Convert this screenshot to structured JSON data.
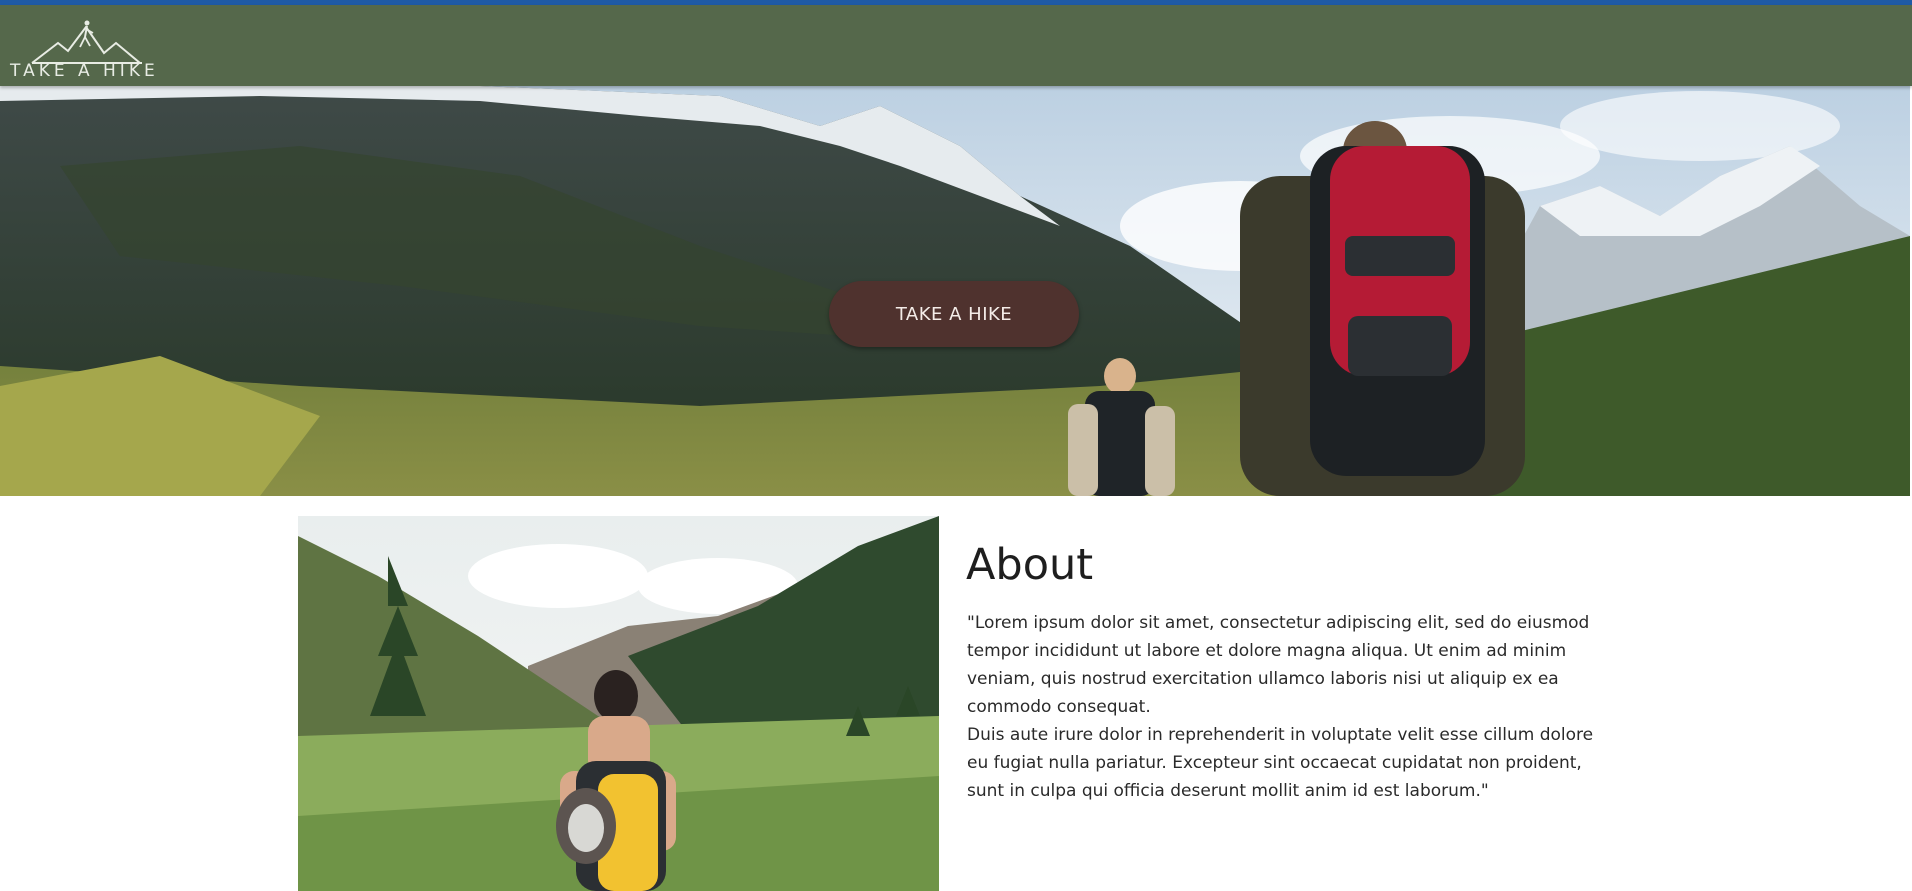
{
  "brand": {
    "name": "TAKE A HIKE",
    "logo_icon": "mountain-hiker-icon"
  },
  "hero": {
    "cta_label": "TAKE A HIKE"
  },
  "about": {
    "title": "About",
    "paragraph_1": "\"Lorem ipsum dolor sit amet, consectetur adipiscing elit, sed do eiusmod tempor incididunt ut labore et dolore magna aliqua. Ut enim ad minim veniam, quis nostrud exercitation ullamco laboris nisi ut aliquip ex ea commodo consequat.",
    "paragraph_2": "Duis aute irure dolor in reprehenderit in voluptate velit esse cillum dolore eu fugiat nulla pariatur. Excepteur sint occaecat cupidatat non proident, sunt in culpa qui officia deserunt mollit anim id est laborum.\""
  },
  "colors": {
    "top_strip": "#1f5aa6",
    "navbar": "#55684b",
    "cta_button": "#4f322e",
    "page_background": "#ffffff"
  }
}
